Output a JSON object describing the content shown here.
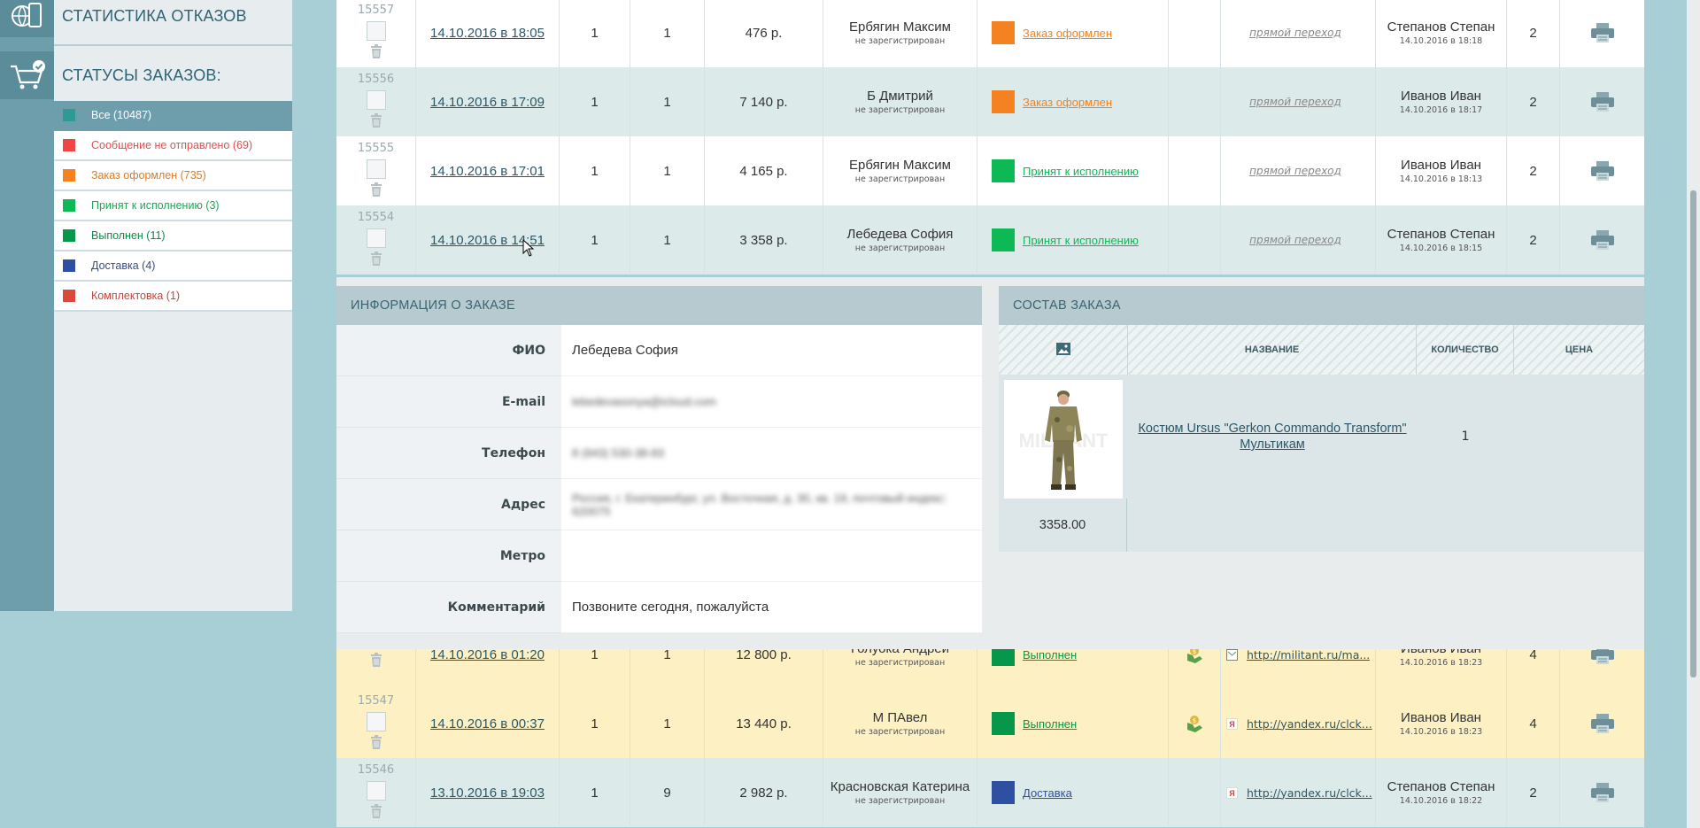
{
  "sidebar": {
    "refusal_stats_title": "СТАТИСТИКА ОТКАЗОВ",
    "order_statuses_title": "СТАТУСЫ ЗАКАЗОВ:",
    "statuses": [
      {
        "label": "Все (10487)",
        "color": "#2d9a96",
        "text_color": "#ffffff",
        "active": true
      },
      {
        "label": "Сообщение не отправлено (69)",
        "color": "#f04545",
        "text_color": "#e05050"
      },
      {
        "label": "Заказ оформлен (735)",
        "color": "#f58220",
        "text_color": "#e07a20"
      },
      {
        "label": "Принят к исполнению (3)",
        "color": "#0cb954",
        "text_color": "#1ea858"
      },
      {
        "label": "Выполнен (11)",
        "color": "#07974a",
        "text_color": "#10884a"
      },
      {
        "label": "Доставка (4)",
        "color": "#2f4fa3",
        "text_color": "#334d8f"
      },
      {
        "label": "Комплектовка (1)",
        "color": "#d94a3c",
        "text_color": "#c94438"
      }
    ]
  },
  "orders_top": [
    {
      "id": "15557",
      "date": "14.10.2016 в 18:05",
      "n1": "1",
      "n2": "1",
      "sum": "476 р.",
      "customer": "Ербягин Максим",
      "customer_sub": "не зарегистрирован",
      "status": "Заказ оформлен",
      "status_color": "#f58220",
      "source": "прямой переход",
      "manager": "Степанов Степан",
      "manager_date": "14.10.2016 в 18:18",
      "count": "2"
    },
    {
      "id": "15556",
      "date": "14.10.2016 в 17:09",
      "n1": "1",
      "n2": "1",
      "sum": "7 140 р.",
      "customer": "Б Дмитрий",
      "customer_sub": "не зарегистрирован",
      "status": "Заказ оформлен",
      "status_color": "#f58220",
      "source": "прямой переход",
      "manager": "Иванов Иван",
      "manager_date": "14.10.2016 в 18:17",
      "count": "2"
    },
    {
      "id": "15555",
      "date": "14.10.2016 в 17:01",
      "n1": "1",
      "n2": "1",
      "sum": "4 165 р.",
      "customer": "Ербягин Максим",
      "customer_sub": "не зарегистрирован",
      "status": "Принят к исполнению",
      "status_color": "#0cb954",
      "source": "прямой переход",
      "manager": "Иванов Иван",
      "manager_date": "14.10.2016 в 18:13",
      "count": "2"
    },
    {
      "id": "15554",
      "date": "14.10.2016 в 14:51",
      "n1": "1",
      "n2": "1",
      "sum": "3 358 р.",
      "customer": "Лебедева София",
      "customer_sub": "не зарегистрирован",
      "status": "Принят к исполнению",
      "status_color": "#0cb954",
      "source": "прямой переход",
      "manager": "Степанов Степан",
      "manager_date": "14.10.2016 в 18:15",
      "count": "2"
    }
  ],
  "order_info": {
    "title": "ИНФОРМАЦИЯ О ЗАКАЗЕ",
    "fields": [
      {
        "label": "ФИО",
        "value": "Лебедева София"
      },
      {
        "label": "E-mail",
        "value": "lebedevasonya@icloud.com",
        "blurred": true
      },
      {
        "label": "Телефон",
        "value": "8 (943) 530-38-83",
        "blurred": true
      },
      {
        "label": "Адрес",
        "value": "Россия, г. Екатеринбург, ул. Восточная, д. 30, кв. 19, почтовый индекс: 620075",
        "blurred": true
      },
      {
        "label": "Метро",
        "value": ""
      },
      {
        "label": "Комментарий",
        "value": "Позвоните сегодня, пожалуйста"
      }
    ]
  },
  "order_composition": {
    "title": "СОСТАВ ЗАКАЗА",
    "col_name": "НАЗВАНИЕ",
    "col_qty": "КОЛИЧЕСТВО",
    "col_price": "ЦЕНА",
    "item": {
      "name": "Костюм Ursus \"Gerkon Commando Transform\" Мультикам",
      "qty": "1",
      "price": "3358.00",
      "watermark": "MILITANT"
    }
  },
  "orders_bottom": [
    {
      "id": "",
      "date": "14.10.2016 в 01:20",
      "n1": "1",
      "n2": "1",
      "sum": "12 800 р.",
      "customer": "Голуока Андрей",
      "customer_sub": "не зарегистрирован",
      "status": "Выполнен",
      "status_color": "#07974a",
      "source": "http://militant.ru/ma...",
      "source_icon": "mail",
      "manager": "Иванов Иван",
      "manager_date": "14.10.2016 в 18:23",
      "count": "4",
      "style": "yellow"
    },
    {
      "id": "15547",
      "date": "14.10.2016 в 00:37",
      "n1": "1",
      "n2": "1",
      "sum": "13 440 р.",
      "customer": "М ПАвел",
      "customer_sub": "не зарегистрирован",
      "status": "Выполнен",
      "status_color": "#07974a",
      "source": "http://yandex.ru/clck...",
      "source_icon": "yandex",
      "manager": "Иванов Иван",
      "manager_date": "14.10.2016 в 18:23",
      "count": "4",
      "style": "yellow"
    },
    {
      "id": "15546",
      "date": "13.10.2016 в 19:03",
      "n1": "1",
      "n2": "9",
      "sum": "2 982 р.",
      "customer": "Красновская Катерина",
      "customer_sub": "не зарегистрирован",
      "status": "Доставка",
      "status_color": "#2f4fa3",
      "source": "http://yandex.ru/clck...",
      "source_icon": "yandex",
      "manager": "Степанов Степан",
      "manager_date": "14.10.2016 в 18:22",
      "count": "2",
      "style": "teal"
    }
  ]
}
